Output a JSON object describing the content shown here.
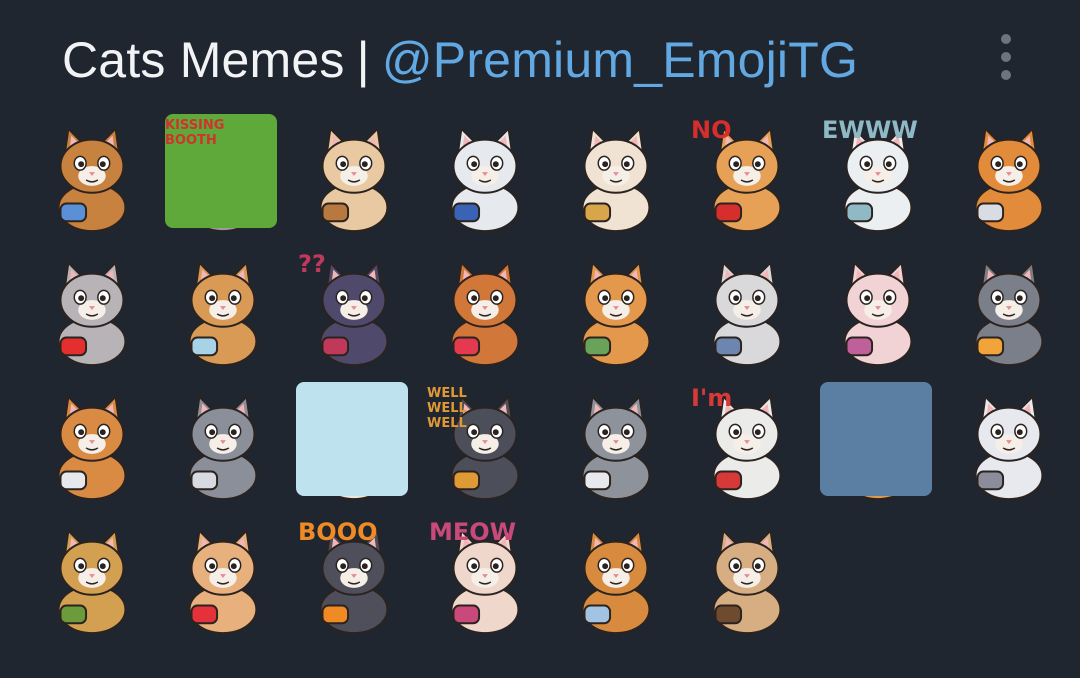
{
  "header": {
    "title": "Cats Memes",
    "separator": "|",
    "link": "@Premium_EmojiTG"
  },
  "menu": {
    "icon": "more-vertical-icon"
  },
  "stickers": [
    {
      "name": "cat-laptop-glasses",
      "fur": "#c8823f",
      "accent": "#5b8fd6"
    },
    {
      "name": "cat-kissing-booth",
      "fur": "#9a9aa4",
      "accent": "#d0332e",
      "tile": "#5fa83a",
      "text": "KISSING BOOTH"
    },
    {
      "name": "cat-thumbs-up",
      "fur": "#e9c9a2",
      "accent": "#b7793e"
    },
    {
      "name": "cat-confused-white",
      "fur": "#e6e9ee",
      "accent": "#3b63b5"
    },
    {
      "name": "cat-straw-hat",
      "fur": "#f0e3d4",
      "accent": "#d8a54a"
    },
    {
      "name": "cat-no",
      "fur": "#e7a156",
      "accent": "#d62d2d",
      "text": "NO"
    },
    {
      "name": "cat-ewww",
      "fur": "#eceff2",
      "accent": "#8fb9c4",
      "text": "EWWW"
    },
    {
      "name": "cat-math",
      "fur": "#e28b3a",
      "accent": "#d9dde3"
    },
    {
      "name": "cat-heart-hug",
      "fur": "#b7b3b7",
      "accent": "#e52f2f"
    },
    {
      "name": "cat-blanket",
      "fur": "#d89a55",
      "accent": "#a8d2e6"
    },
    {
      "name": "cat-question",
      "fur": "#4f4a6b",
      "accent": "#c0395b",
      "text": "??"
    },
    {
      "name": "cat-love-eyes",
      "fur": "#d2773a",
      "accent": "#e33a4f"
    },
    {
      "name": "cat-money",
      "fur": "#e3984c",
      "accent": "#6aa25a"
    },
    {
      "name": "cat-belly",
      "fur": "#d9d9dc",
      "accent": "#6d86b0"
    },
    {
      "name": "cat-pink-sparkle",
      "fur": "#f1d3d6",
      "accent": "#c0609b"
    },
    {
      "name": "cat-birthday",
      "fur": "#7a7f8a",
      "accent": "#f0a43a"
    },
    {
      "name": "cat-pillow",
      "fur": "#d98a43",
      "accent": "#e6e8ee"
    },
    {
      "name": "cat-knife",
      "fur": "#8b8f99",
      "accent": "#d7dade"
    },
    {
      "name": "cat-desert-hat",
      "fur": "#ece6df",
      "accent": "#c7863f",
      "tile": "#bfe3ee"
    },
    {
      "name": "cat-well",
      "fur": "#4c4e5a",
      "accent": "#e09a35",
      "text": "WELL WELL WELL"
    },
    {
      "name": "cat-pray",
      "fur": "#8e929b",
      "accent": "#e7e9ed"
    },
    {
      "name": "cat-microphone",
      "fur": "#ebebea",
      "accent": "#d73838",
      "text": "I'm"
    },
    {
      "name": "cat-rain-window",
      "fur": "#e09a4e",
      "accent": "#4f7ea8",
      "tile": "#5b7fa3"
    },
    {
      "name": "cat-lying",
      "fur": "#e8e9ee",
      "accent": "#8b8e9a"
    },
    {
      "name": "cat-bengal-phone",
      "fur": "#d3a052",
      "accent": "#6b9b3a"
    },
    {
      "name": "cat-heart-glasses",
      "fur": "#e7b07c",
      "accent": "#e3323a"
    },
    {
      "name": "cat-pumpkin",
      "fur": "#4f4e5b",
      "accent": "#f08a25",
      "text": "BOOO"
    },
    {
      "name": "cat-meow",
      "fur": "#f0d7cc",
      "accent": "#c94a7a",
      "text": "MEOW"
    },
    {
      "name": "cat-bed-laptop",
      "fur": "#d88b3e",
      "accent": "#a3c3e3"
    },
    {
      "name": "cat-grumpy",
      "fur": "#d6ae82",
      "accent": "#6e4b2e"
    }
  ]
}
